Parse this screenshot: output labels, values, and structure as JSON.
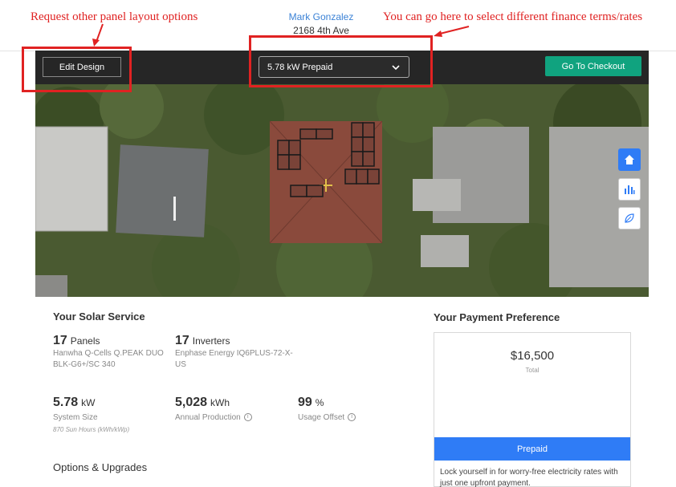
{
  "annotations": {
    "left": "Request other panel layout options",
    "right": "You can go here to select different finance terms/rates"
  },
  "customer": {
    "name": "Mark Gonzalez",
    "address": "2168 4th Ave"
  },
  "toolbar": {
    "edit_design": "Edit Design",
    "plan_selected": "5.78 kW Prepaid",
    "checkout": "Go To Checkout"
  },
  "side_buttons": [
    "home-icon",
    "bar-chart-icon",
    "leaf-icon"
  ],
  "solar_service": {
    "title": "Your Solar Service",
    "panels": {
      "count": "17",
      "label": "Panels",
      "model": "Hanwha Q-Cells Q.PEAK DUO BLK-G6+/SC 340"
    },
    "inverters": {
      "count": "17",
      "label": "Inverters",
      "model": "Enphase Energy IQ6PLUS-72-X-US"
    },
    "system_size": {
      "value": "5.78",
      "unit": "kW",
      "label": "System Size",
      "note": "870 Sun Hours (kWh/kWp)"
    },
    "annual_production": {
      "value": "5,028",
      "unit": "kWh",
      "label": "Annual Production"
    },
    "usage_offset": {
      "value": "99",
      "unit": "%",
      "label": "Usage Offset"
    }
  },
  "options_title": "Options & Upgrades",
  "payment": {
    "title": "Your Payment Preference",
    "price": "$16,500",
    "price_label": "Total",
    "plan": "Prepaid",
    "description": "Lock yourself in for worry-free electricity rates with just one upfront payment."
  },
  "colors": {
    "accent_green": "#10a37f",
    "accent_blue": "#2f7cf6",
    "annotation_red": "#e02222",
    "link_blue": "#3b82d6"
  }
}
